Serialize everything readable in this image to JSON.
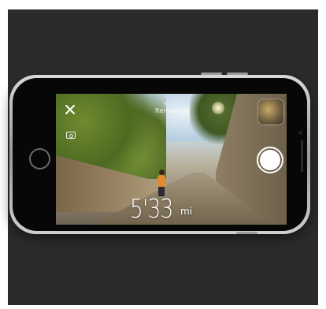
{
  "camera_app": {
    "header_label": "Remaining",
    "pace_value": "5'33",
    "pace_unit": "mi",
    "page_indicator": "• •"
  },
  "colors": {
    "background": "#2b2b2b",
    "shutter": "#ffffff",
    "runner_shirt": "#e38a2e"
  },
  "icons": [
    "close-icon",
    "flip-camera-icon",
    "shutter-button",
    "photo-thumbnail"
  ]
}
